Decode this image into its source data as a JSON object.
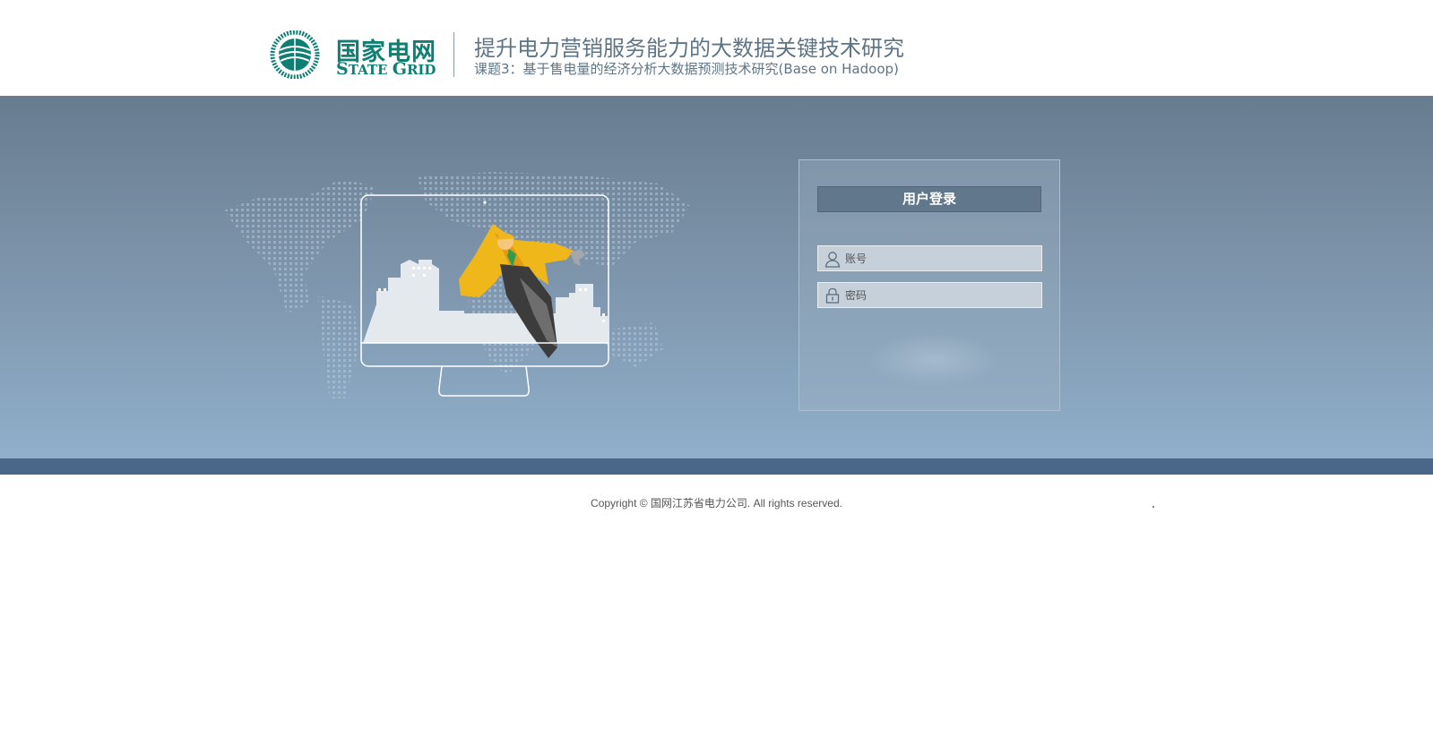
{
  "header": {
    "logo_cn": "国家电网",
    "logo_en_cap1": "S",
    "logo_en_rest1": "TATE ",
    "logo_en_cap2": "G",
    "logo_en_rest2": "RID",
    "title": "提升电力营销服务能力的大数据关键技术研究",
    "subtitle": "课题3：基于售电量的经济分析大数据预测技术研究(Base on Hadoop)"
  },
  "login": {
    "title": "用户登录",
    "username_placeholder": "账号",
    "password_placeholder": "密码"
  },
  "footer": {
    "copyright": "Copyright © 国网江苏省电力公司. All rights reserved."
  },
  "colors": {
    "brand_green": "#0f7f74",
    "banner_top": "#687c90",
    "banner_bottom": "#90afca",
    "footer_bar": "#4a6789",
    "login_title_bg": "#61778b"
  },
  "icons": [
    "state-grid-emblem-icon",
    "user-icon",
    "lock-icon"
  ]
}
